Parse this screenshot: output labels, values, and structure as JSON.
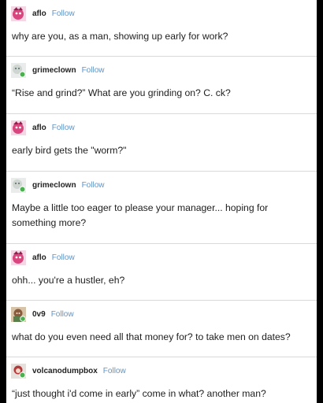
{
  "follow_label": "Follow",
  "posts": [
    {
      "username": "aflo",
      "text": "why are you, as a man, showing up early for work?"
    },
    {
      "username": "grimeclown",
      "text": "“Rise and grind?” What are you grinding on? C. ck?"
    },
    {
      "username": "aflo",
      "text": "early bird gets the \"worm?\""
    },
    {
      "username": "grimeclown",
      "text": "Maybe a little too eager to please your manager... hoping for something more?"
    },
    {
      "username": "aflo",
      "text": "ohh... you're a hustler, eh?"
    },
    {
      "username": "0v9",
      "text": "what do you even need all that money for? to take men on dates?"
    },
    {
      "username": "volcanodumpbox",
      "text": "“just thought i'd come in early” come in what? another man?"
    }
  ],
  "colors": {
    "follow": "#5f93c4",
    "text": "#1d1d1d",
    "online_dot": "#4caf50"
  },
  "icons": {
    "aflo_avatar": "pink-cartoon-avatar-icon",
    "grimeclown_avatar": "clown-avatar-icon",
    "0v9_avatar": "character-avatar-icon",
    "volcanodumpbox_avatar": "character-avatar-icon"
  }
}
